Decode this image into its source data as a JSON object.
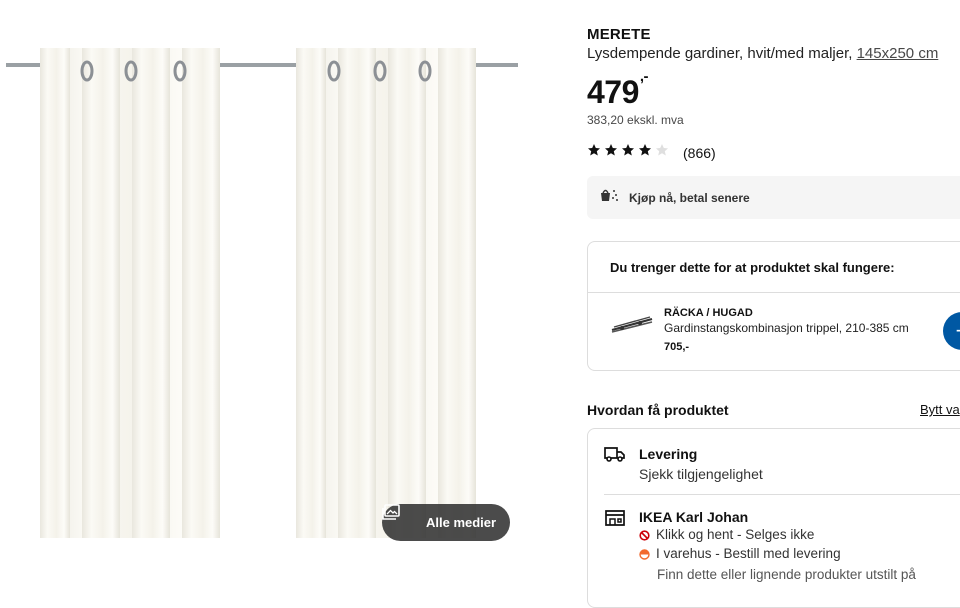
{
  "gallery": {
    "all_media_label": "Alle medier",
    "all_media_icon": "image-stack-icon"
  },
  "product": {
    "name": "MERETE",
    "description": "Lysdempende gardiner, hvit/med maljer, ",
    "size": "145x250 cm",
    "price": "479",
    "price_suffix": ",-",
    "price_excl_vat": "383,20 ekskl. mva",
    "rating": {
      "stars": 4,
      "max": 5,
      "count": "(866)"
    }
  },
  "klarna": {
    "label": "Kjøp nå, betal senere",
    "icon": "klarna-payment-icon"
  },
  "needed": {
    "title": "Du trenger dette for at produktet skal fungere:",
    "item": {
      "name": "RÄCKA / HUGAD",
      "description": "Gardinstangskombinasjon trippel, 210-385 cm",
      "price": "705,-",
      "add_icon": "plus-icon"
    }
  },
  "how": {
    "title": "Hvordan få produktet",
    "change_label": "Bytt va"
  },
  "delivery": {
    "title": "Levering",
    "subtitle": "Sjekk tilgjengelighet",
    "icon": "truck-icon"
  },
  "store": {
    "title": "IKEA Karl Johan",
    "icon": "store-icon",
    "click_collect": "Klikk og hent - Selges ikke",
    "in_store": "I varehus - Bestill med levering",
    "find_more": "Finn dette eller lignende produkter utstilt på"
  },
  "colors": {
    "brand_blue": "#0058a3",
    "status_red": "#cc0008",
    "status_orange": "#f26a2f",
    "text": "#111111"
  }
}
